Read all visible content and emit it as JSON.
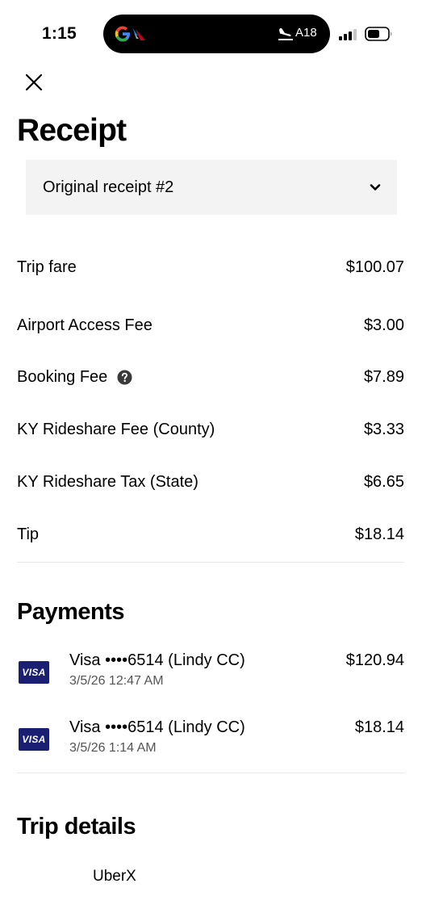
{
  "status_bar": {
    "time": "1:15",
    "island_gate": "A18",
    "colors": {
      "island": "#000000"
    }
  },
  "header": {
    "close_icon": "close-icon",
    "title": "Receipt"
  },
  "receipt_selector": {
    "selected": "Original receipt #2",
    "icon": "chevron-down-icon"
  },
  "fare_items": [
    {
      "label": "Trip fare",
      "amount": "$100.07"
    },
    {
      "label": "Airport Access Fee",
      "amount": "$3.00"
    },
    {
      "label": "Booking Fee",
      "amount": "$7.89",
      "icon": "help-icon"
    },
    {
      "label": "KY Rideshare Fee (County)",
      "amount": "$3.33"
    },
    {
      "label": "KY Rideshare Tax (State)",
      "amount": "$6.65"
    },
    {
      "label": "Tip",
      "amount": "$18.14"
    }
  ],
  "payments": {
    "title": "Payments",
    "items": [
      {
        "card_brand": "VISA",
        "name": "Visa ••••6514 (Lindy CC)",
        "date": "3/5/26 12:47 AM",
        "amount": "$120.94"
      },
      {
        "card_brand": "VISA",
        "name": "Visa ••••6514 (Lindy CC)",
        "date": "3/5/26 1:14 AM",
        "amount": "$18.14"
      }
    ]
  },
  "trip_details": {
    "title": "Trip details",
    "vehicle": "UberX"
  },
  "colors": {
    "visa_blue": "#1a1f71",
    "select_background": "#f3f3f3",
    "divider": "#e8e8e8",
    "secondary_text": "#545454"
  }
}
